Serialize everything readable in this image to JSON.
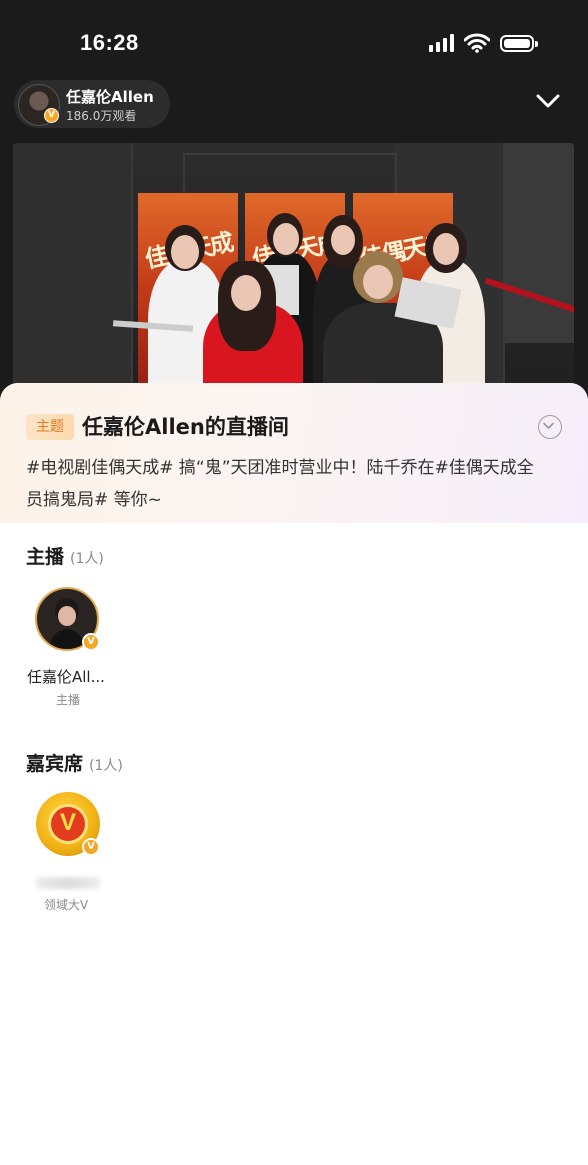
{
  "status_bar": {
    "time": "16:28",
    "icons": [
      "signal-icon",
      "wifi-icon",
      "battery-icon"
    ]
  },
  "host_chip": {
    "name": "任嘉伦Allen",
    "viewers": "186.0万观看",
    "badge": "V"
  },
  "video": {
    "banner_text": "佳偶天成"
  },
  "room_info": {
    "tag": "主题",
    "title": "任嘉伦Allen的直播间",
    "description": "#电视剧佳偶天成# 搞“鬼”天团准时营业中！陆千乔在#佳偶天成全员搞鬼局# 等你~"
  },
  "anchor_section": {
    "title": "主播",
    "count": "(1人)",
    "members": [
      {
        "name": "任嘉伦All...",
        "role": "主播",
        "badge": "V"
      }
    ]
  },
  "guest_section": {
    "title": "嘉宾席",
    "count": "(1人)",
    "members": [
      {
        "name": "",
        "role": "领域大V",
        "badge": "V",
        "avatar_letter": "V"
      }
    ]
  },
  "colors": {
    "accent_orange": "#f5a623",
    "topic_tag_text": "#e07a1e",
    "gold_avatar": "#f3b416"
  }
}
